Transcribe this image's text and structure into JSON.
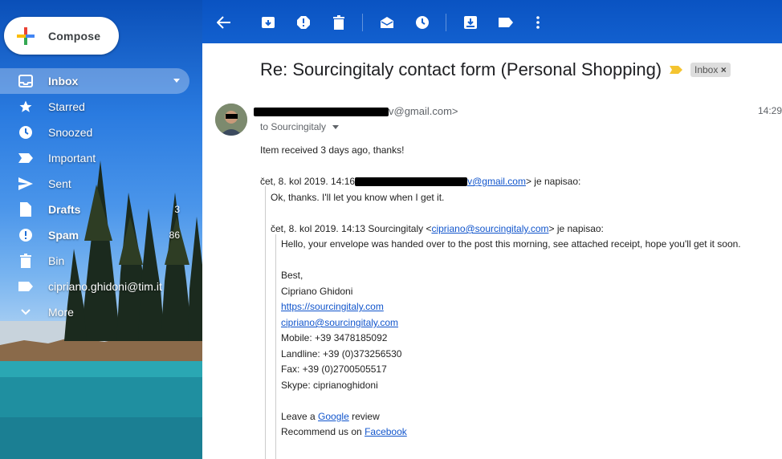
{
  "sidebar": {
    "compose_label": "Compose",
    "items": [
      {
        "label": "Inbox",
        "icon": "inbox-icon",
        "count": ""
      },
      {
        "label": "Starred",
        "icon": "star-icon",
        "count": ""
      },
      {
        "label": "Snoozed",
        "icon": "clock-icon",
        "count": ""
      },
      {
        "label": "Important",
        "icon": "important-icon",
        "count": ""
      },
      {
        "label": "Sent",
        "icon": "send-icon",
        "count": ""
      },
      {
        "label": "Drafts",
        "icon": "draft-icon",
        "count": "3"
      },
      {
        "label": "Spam",
        "icon": "spam-icon",
        "count": "86"
      },
      {
        "label": "Bin",
        "icon": "trash-icon",
        "count": ""
      },
      {
        "label": "cipriano.ghidoni@tim.it",
        "icon": "label-icon",
        "count": ""
      },
      {
        "label": "More",
        "icon": "chevron-down-icon",
        "count": ""
      }
    ]
  },
  "toolbar": {
    "icons": [
      "back-arrow-icon",
      "archive-icon",
      "report-spam-icon",
      "delete-icon",
      "mark-unread-icon",
      "snooze-icon",
      "move-to-icon",
      "labels-icon",
      "more-vert-icon"
    ]
  },
  "message": {
    "subject": "Re: Sourcingitaly contact form (Personal Shopping)",
    "chip": "Inbox",
    "sender_visible": "v@gmail.com>",
    "to_label": "to Sourcingitaly",
    "time": "14:29",
    "reply_text": "Item received 3 days ago, thanks!",
    "quote1_header_start": "čet, 8. kol 2019. 14:16",
    "quote1_email": "v@gmail.com",
    "quote1_header_end": "> je napisao:",
    "quote1_text": "Ok, thanks. I'll let you know when I get it.",
    "quote2_header_start": "čet, 8. kol 2019. 14:13 Sourcingitaly <",
    "quote2_email": "cipriano@sourcingitaly.com",
    "quote2_header_end": "> je napisao:",
    "quote2_text": "Hello, your envelope was handed over to the post this morning, see attached receipt, hope you'll get it soon.",
    "sig_best": "Best,",
    "sig_name": "Cipriano Ghidoni",
    "sig_url": "https://sourcingitaly.com",
    "sig_email": "cipriano@sourcingitaly.com",
    "sig_mobile": "Mobile: +39 3478185092",
    "sig_landline": "Landline: +39 (0)373256530",
    "sig_fax": "Fax: +39 (0)2700505517",
    "sig_skype": "Skype: ciprianoghidoni",
    "leave_prefix": "Leave a ",
    "leave_link": "Google",
    "leave_suffix": " review",
    "recommend_prefix": "Recommend us on ",
    "recommend_link": "Facebook"
  },
  "colors": {
    "topbar": "#0a53c2",
    "link": "#1155cc",
    "chip_bg": "#dddddd"
  }
}
